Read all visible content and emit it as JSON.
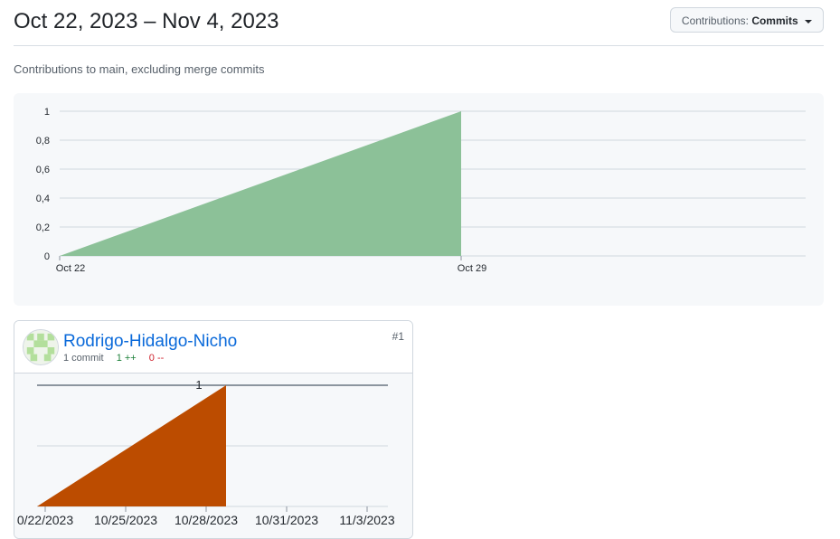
{
  "header": {
    "date_range": "Oct 22, 2023 – Nov 4, 2023",
    "contrib_button": {
      "prefix": "Contributions:",
      "value": "Commits"
    }
  },
  "subtitle": "Contributions to main, excluding merge commits",
  "colors": {
    "main_area": "#8cc198",
    "user_area": "#bc4c00",
    "link": "#0969da",
    "additions": "#1a7f37",
    "deletions": "#cf222e"
  },
  "chart_data": [
    {
      "type": "area",
      "x": [
        "Oct 22",
        "Oct 29"
      ],
      "y": [
        0,
        1
      ],
      "ylim": [
        0,
        1
      ],
      "yticks": [
        "0",
        "0,2",
        "0,4",
        "0,6",
        "0,8",
        "1"
      ],
      "xticks": [
        "Oct 22",
        "Oct 29"
      ],
      "grid": true
    },
    {
      "type": "area",
      "x": [
        "10/22/2023",
        "10/28/2023"
      ],
      "y": [
        0,
        1
      ],
      "ylim": [
        0,
        1
      ],
      "yticks": [
        "1"
      ],
      "xticks": [
        "0/22/2023",
        "10/25/2023",
        "10/28/2023",
        "10/31/2023",
        "11/3/2023"
      ],
      "grid": true
    }
  ],
  "contributor": {
    "name": "Rodrigo-Hidalgo-Nicho",
    "commits": "1 commit",
    "additions": "1 ++",
    "deletions": "0 --",
    "rank": "#1",
    "avatar_icon": "identicon-avatar"
  }
}
